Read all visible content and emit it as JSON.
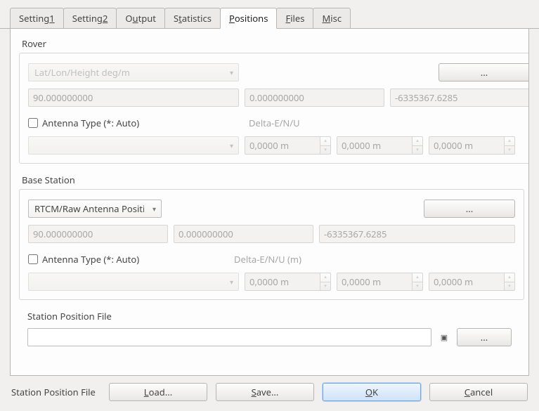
{
  "tabs": [
    {
      "label_pre": "Setting",
      "mn": "1",
      "label_post": ""
    },
    {
      "label_pre": "Setting",
      "mn": "2",
      "label_post": ""
    },
    {
      "label_pre": "O",
      "mn": "u",
      "label_post": "tput"
    },
    {
      "label_pre": "S",
      "mn": "t",
      "label_post": "atistics"
    },
    {
      "label_pre": "",
      "mn": "P",
      "label_post": "ositions",
      "active": true
    },
    {
      "label_pre": "",
      "mn": "F",
      "label_post": "iles"
    },
    {
      "label_pre": "",
      "mn": "M",
      "label_post": "isc"
    }
  ],
  "rover": {
    "title": "Rover",
    "format_selected": "Lat/Lon/Height deg/m",
    "browse_label": "...",
    "coord1": "90.000000000",
    "coord2": "0.000000000",
    "coord3": "-6335367.6285",
    "antenna_checkbox": "Antenna Type (*: Auto)",
    "delta_label": "Delta-E/N/U",
    "antenna_type": "",
    "offset1": "0,0000 m",
    "offset2": "0,0000 m",
    "offset3": "0,0000 m"
  },
  "base": {
    "title": "Base Station",
    "format_selected": "RTCM/Raw Antenna Position",
    "browse_label": "...",
    "coord1": "90.000000000",
    "coord2": "0.000000000",
    "coord3": "-6335367.6285",
    "antenna_checkbox": "Antenna Type (*: Auto)",
    "delta_label": "Delta-E/N/U (m)",
    "antenna_type": "",
    "offset1": "0,0000 m",
    "offset2": "0,0000 m",
    "offset3": "0,0000 m"
  },
  "station_file": {
    "label": "Station Position File",
    "value": "",
    "view_icon": "▣",
    "browse_label": "..."
  },
  "footer": {
    "label": "Station Position File",
    "load": {
      "pre": "",
      "mn": "L",
      "post": "oad..."
    },
    "save": {
      "pre": "",
      "mn": "S",
      "post": "ave..."
    },
    "ok": {
      "pre": "",
      "mn": "O",
      "post": "K"
    },
    "cancel": {
      "pre": "",
      "mn": "C",
      "post": "ancel"
    }
  }
}
